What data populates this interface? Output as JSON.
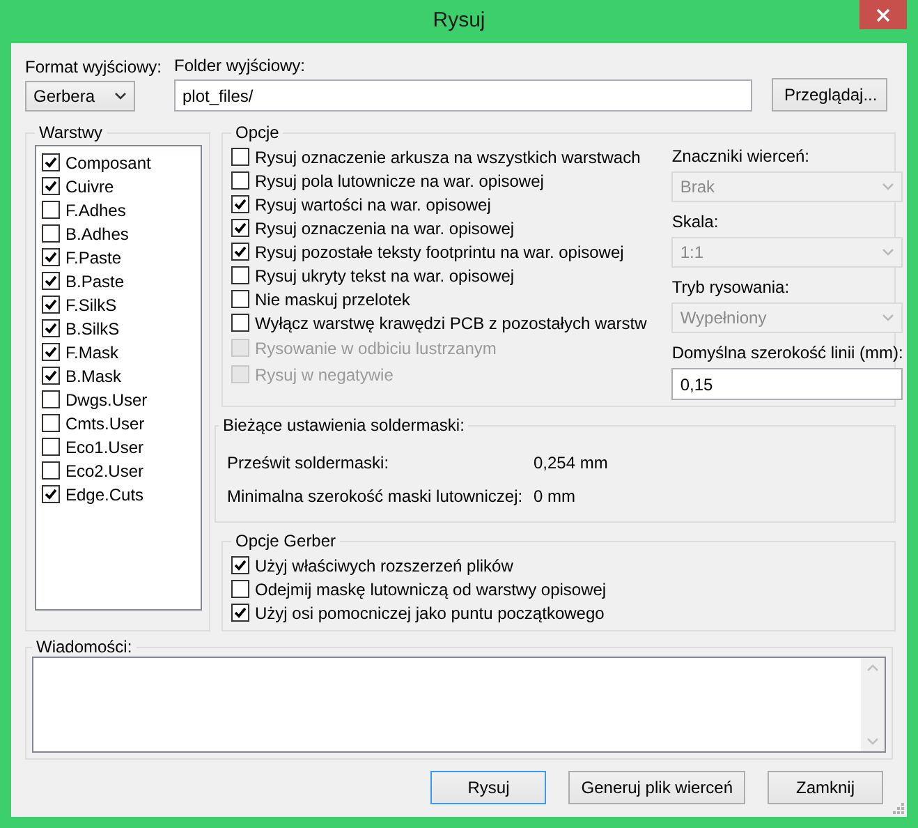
{
  "window": {
    "title": "Rysuj"
  },
  "output_format": {
    "label": "Format wyjściowy:",
    "value": "Gerbera"
  },
  "output_folder": {
    "label": "Folder wyjściowy:",
    "value": "plot_files/",
    "browse_button": "Przeglądaj..."
  },
  "layers": {
    "title": "Warstwy",
    "items": [
      {
        "label": "Composant",
        "checked": true
      },
      {
        "label": "Cuivre",
        "checked": true
      },
      {
        "label": "F.Adhes",
        "checked": false
      },
      {
        "label": "B.Adhes",
        "checked": false
      },
      {
        "label": "F.Paste",
        "checked": true
      },
      {
        "label": "B.Paste",
        "checked": true
      },
      {
        "label": "F.SilkS",
        "checked": true
      },
      {
        "label": "B.SilkS",
        "checked": true
      },
      {
        "label": "F.Mask",
        "checked": true
      },
      {
        "label": "B.Mask",
        "checked": true
      },
      {
        "label": "Dwgs.User",
        "checked": false
      },
      {
        "label": "Cmts.User",
        "checked": false
      },
      {
        "label": "Eco1.User",
        "checked": false
      },
      {
        "label": "Eco2.User",
        "checked": false
      },
      {
        "label": "Edge.Cuts",
        "checked": true
      }
    ]
  },
  "options": {
    "title": "Opcje",
    "items": [
      {
        "label": "Rysuj oznaczenie arkusza na wszystkich warstwach",
        "checked": false,
        "disabled": false
      },
      {
        "label": "Rysuj pola lutownicze na war. opisowej",
        "checked": false,
        "disabled": false
      },
      {
        "label": "Rysuj wartości na war. opisowej",
        "checked": true,
        "disabled": false
      },
      {
        "label": "Rysuj oznaczenia na war. opisowej",
        "checked": true,
        "disabled": false
      },
      {
        "label": "Rysuj pozostałe teksty footprintu na war. opisowej",
        "checked": true,
        "disabled": false
      },
      {
        "label": "Rysuj ukryty tekst na war. opisowej",
        "checked": false,
        "disabled": false
      },
      {
        "label": "Nie maskuj przelotek",
        "checked": false,
        "disabled": false
      },
      {
        "label": "Wyłącz warstwę krawędzi PCB z pozostałych warstw",
        "checked": false,
        "disabled": false
      },
      {
        "label": "Rysowanie w odbiciu lustrzanym",
        "checked": false,
        "disabled": true
      },
      {
        "label": "Rysuj w negatywie",
        "checked": false,
        "disabled": true
      }
    ],
    "selects": [
      {
        "label": "Znaczniki wierceń:",
        "value": "Brak",
        "disabled": true
      },
      {
        "label": "Skala:",
        "value": "1:1",
        "disabled": true
      },
      {
        "label": "Tryb rysowania:",
        "value": "Wypełniony",
        "disabled": true
      }
    ],
    "line_width": {
      "label": "Domyślna szerokość linii (mm):",
      "value": "0,15"
    }
  },
  "soldermask": {
    "title": "Bieżące ustawienia soldermaski:",
    "rows": [
      {
        "label": "Prześwit soldermaski:",
        "value": "0,254 mm"
      },
      {
        "label": "Minimalna szerokość maski lutowniczej:",
        "value": "0 mm"
      }
    ]
  },
  "gerber_options": {
    "title": "Opcje Gerber",
    "items": [
      {
        "label": "Użyj właściwych rozszerzeń plików",
        "checked": true
      },
      {
        "label": "Odejmij maskę lutowniczą od warstwy opisowej",
        "checked": false
      },
      {
        "label": "Użyj osi pomocniczej jako puntu początkowego",
        "checked": true
      }
    ]
  },
  "messages": {
    "title": "Wiadomości:"
  },
  "buttons": [
    {
      "label": "Rysuj",
      "focused": true
    },
    {
      "label": "Generuj plik wierceń",
      "focused": false
    },
    {
      "label": "Zamknij",
      "focused": false
    }
  ]
}
